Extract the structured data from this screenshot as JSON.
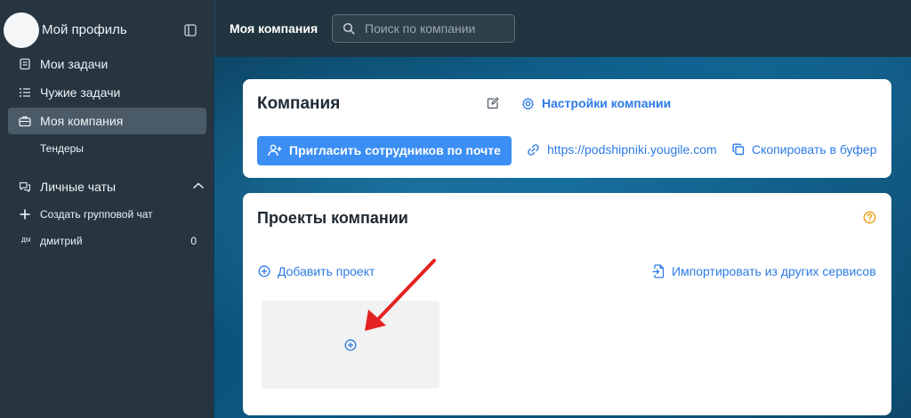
{
  "sidebar": {
    "profile_name": "Мой профиль",
    "items": [
      {
        "label": "Мои задачи",
        "icon": "task-list-icon"
      },
      {
        "label": "Чужие задачи",
        "icon": "list-icon"
      },
      {
        "label": "Моя компания",
        "icon": "briefcase-icon",
        "active": true
      }
    ],
    "sub_item": "Тендеры",
    "chats_section": "Личные чаты",
    "create_group_chat": "Создать групповой чат",
    "dm": {
      "initials": "ДМ",
      "name": "дмитрий",
      "count": "0"
    }
  },
  "header": {
    "title": "Моя компания",
    "search_placeholder": "Поиск по компании"
  },
  "company_card": {
    "title": "Компания",
    "settings_label": "Настройки компании",
    "invite_label": "Пригласить сотрудников по почте",
    "link_url": "https://podshipniki.yougile.com",
    "copy_label": "Скопировать в буфер"
  },
  "projects_card": {
    "title": "Проекты компании",
    "add_project_label": "Добавить проект",
    "import_label": "Импортировать из других сервисов"
  },
  "colors": {
    "sidebar_bg": "#263540",
    "accent": "#3b8ef3",
    "link": "#2c7be5",
    "help": "#f0a020",
    "arrow": "#e52222"
  }
}
